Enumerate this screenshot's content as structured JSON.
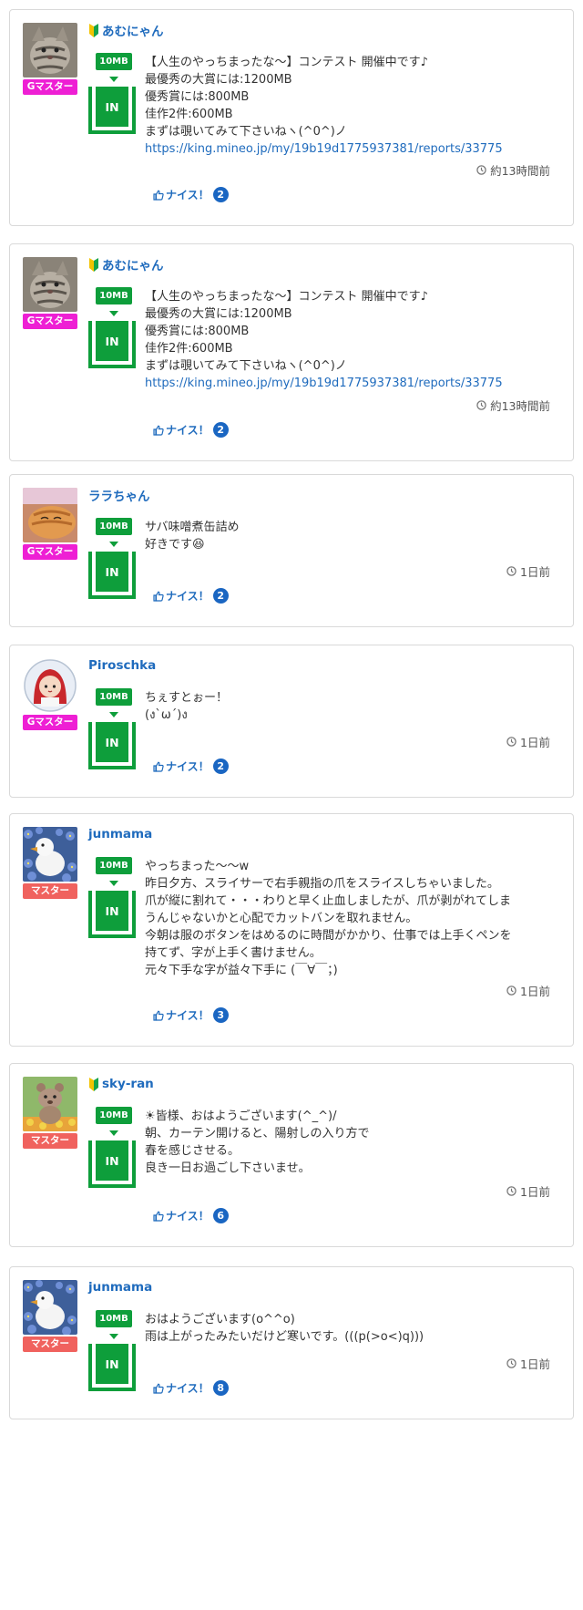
{
  "labels": {
    "capacity": "10MB",
    "in": "IN",
    "nice": "ナイス！"
  },
  "colors": {
    "link": "#1f6bbd",
    "green": "#0e9e3b",
    "g_master": "#ee1fd4",
    "master": "#f0625e",
    "count_badge": "#1a66c2"
  },
  "posts": [
    {
      "user": "あむにゃん",
      "beginner": true,
      "badge": "Gマスター",
      "avatar": "cat-gray-avatar",
      "lines": [
        "【人生のやっちまったな〜】コンテスト 開催中です♪",
        "最優秀の大賞には:1200MB",
        "優秀賞には:800MB",
        "佳作2件:600MB",
        "まずは覗いてみて下さいねヽ(^0^)ノ"
      ],
      "link": "https://king.mineo.jp/my/19b19d1775937381/reports/33775",
      "time": "約13時間前",
      "nice_count": "2"
    },
    {
      "user": "あむにゃん",
      "beginner": true,
      "badge": "Gマスター",
      "avatar": "cat-gray-avatar",
      "lines": [
        "【人生のやっちまったな〜】コンテスト 開催中です♪",
        "最優秀の大賞には:1200MB",
        "優秀賞には:800MB",
        "佳作2件:600MB",
        "まずは覗いてみて下さいねヽ(^0^)ノ"
      ],
      "link": "https://king.mineo.jp/my/19b19d1775937381/reports/33775",
      "time": "約13時間前",
      "nice_count": "2"
    },
    {
      "user": "ララちゃん",
      "beginner": false,
      "badge": "Gマスター",
      "avatar": "cat-orange-avatar",
      "lines": [
        "サバ味噌煮缶詰め",
        "好きです😆"
      ],
      "link": "",
      "time": "1日前",
      "nice_count": "2"
    },
    {
      "user": "Piroschka",
      "beginner": false,
      "badge": "Gマスター",
      "avatar": "red-hood-avatar",
      "lines": [
        "ちぇすとぉー！",
        "(ง`ω´)ง"
      ],
      "link": "",
      "time": "1日前",
      "nice_count": "2"
    },
    {
      "user": "junmama",
      "beginner": false,
      "badge": "マスター",
      "avatar": "duck-flowers-avatar",
      "lines": [
        "やっちまった〜〜w",
        "昨日夕方、スライサーで右手親指の爪をスライスしちゃいました。",
        "爪が縦に割れて・・・わりと早く止血しましたが、爪が剥がれてしま",
        "うんじゃないかと心配でカットバンを取れません。",
        "今朝は服のボタンをはめるのに時間がかかり、仕事では上手くペンを",
        "持てず、字が上手く書けません。",
        "元々下手な字が益々下手に (￣∀￣；)"
      ],
      "link": "",
      "time": "1日前",
      "nice_count": "3"
    },
    {
      "user": "sky-ran",
      "beginner": true,
      "badge": "マスター",
      "avatar": "bear-toy-avatar",
      "lines": [
        "☀皆様、おはようございます(^_^)/",
        "朝、カーテン開けると、陽射しの入り方で",
        "春を感じさせる。",
        "良き一日お過ごし下さいませ。"
      ],
      "link": "",
      "time": "1日前",
      "nice_count": "6"
    },
    {
      "user": "junmama",
      "beginner": false,
      "badge": "マスター",
      "avatar": "duck-flowers-avatar",
      "lines": [
        "おはようございます(o^^o)",
        "雨は上がったみたいだけど寒いです。(((p(>o<)q)))"
      ],
      "link": "",
      "time": "1日前",
      "nice_count": "8"
    }
  ]
}
